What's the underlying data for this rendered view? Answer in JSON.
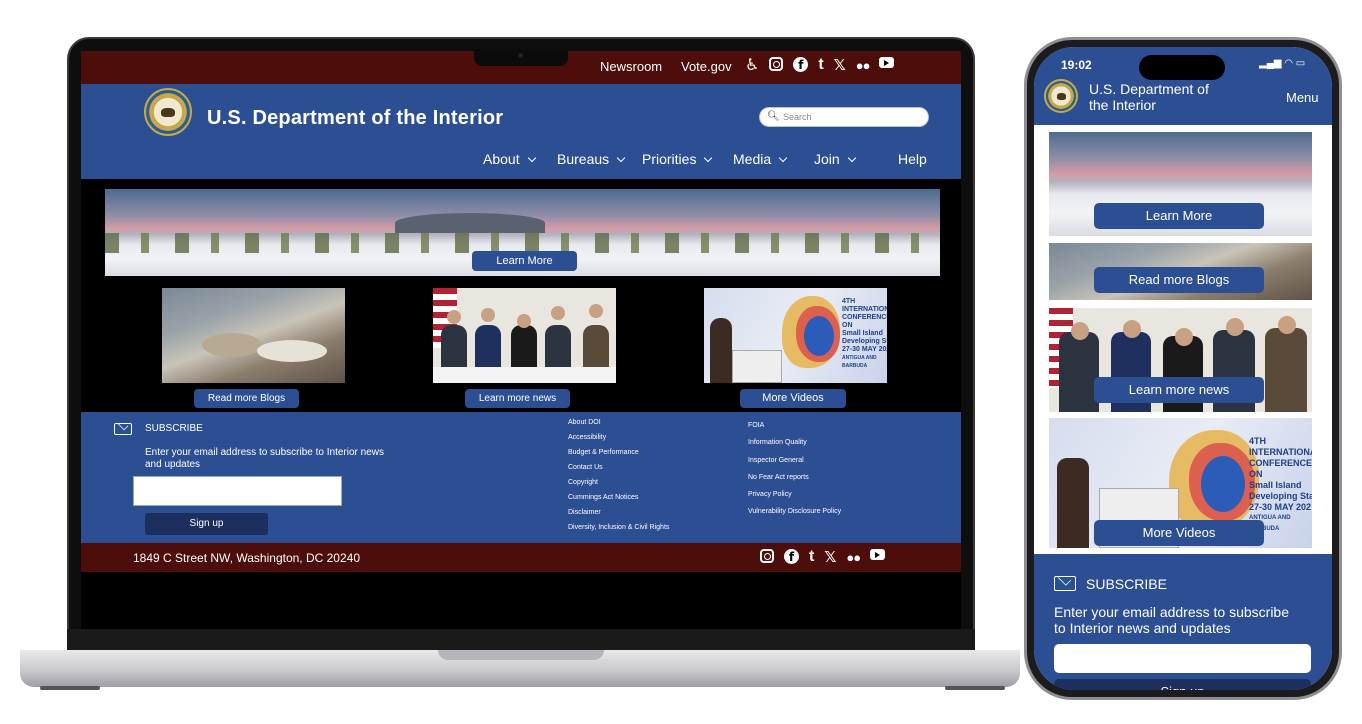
{
  "site": {
    "title": "U.S. Department of  the Interior",
    "mobile_title_line1": "U.S. Department of",
    "mobile_title_line2": "the Interior"
  },
  "topbar": {
    "links": [
      "Newsroom",
      "Vote.gov"
    ],
    "icons": [
      "accessibility-icon",
      "instagram-icon",
      "facebook-icon",
      "tumblr-icon",
      "x-icon",
      "flickr-icon",
      "youtube-icon"
    ]
  },
  "search": {
    "placeholder": "Search"
  },
  "nav": {
    "items": [
      {
        "label": "About"
      },
      {
        "label": "Bureaus"
      },
      {
        "label": "Priorities"
      },
      {
        "label": "Media"
      },
      {
        "label": "Join"
      },
      {
        "label": "Help"
      }
    ]
  },
  "hero": {
    "button": "Learn More"
  },
  "cards": [
    {
      "button": "Read more Blogs"
    },
    {
      "button": "Learn more news"
    },
    {
      "button": "More Videos"
    }
  ],
  "conference_image_text": [
    "4TH INTERNATIONAL",
    "CONFERENCE ON",
    "Small Island",
    "Developing Sta",
    "27-30 MAY 202",
    "ANTIGUA AND BARBUDA"
  ],
  "footer": {
    "subscribe_heading": "SUBSCRIBE",
    "subscribe_text": "Enter your email address to subscribe to Interior news and updates",
    "signup_button": "Sign up",
    "links_col1": [
      "About DOI",
      "Accessibility",
      "Budget & Performance",
      "Contact Us",
      "Copyright",
      "Cummings Act Notices",
      "Disclaimer",
      "Diversity, Inclusion & Civil Rights"
    ],
    "links_col2": [
      "FOIA",
      "Information Quality",
      "Inspector General",
      "No Fear Act reports",
      "Privacy Policy",
      "Vulnerability Disclosure Policy"
    ]
  },
  "bottombar": {
    "address": "1849 C Street NW, Washington, DC 20240"
  },
  "mobile": {
    "time": "19:02",
    "menu": "Menu",
    "buttons": [
      "Learn More",
      "Read more Blogs",
      "Learn more news",
      "More Videos"
    ],
    "subscribe_heading": "SUBSCRIBE",
    "subscribe_text_line1": "Enter your email address to subscribe",
    "subscribe_text_line2": "to Interior news and updates",
    "signup_partial": "Sign up"
  },
  "colors": {
    "brand_blue": "#2c4e93",
    "maroon": "#4d0d0a"
  }
}
